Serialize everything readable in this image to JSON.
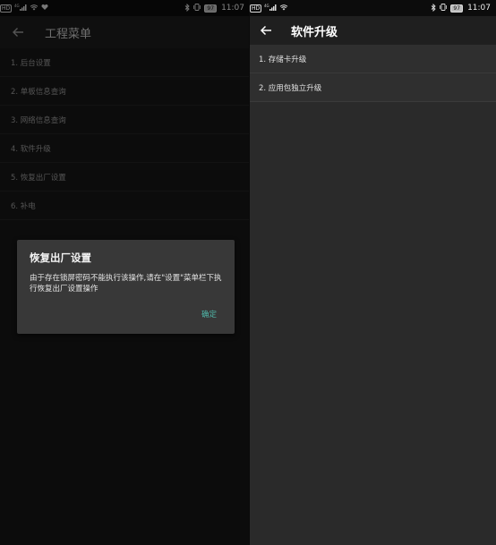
{
  "left_screen": {
    "status_bar": {
      "hd": "HD",
      "signal": "4G",
      "battery": "97",
      "time": "11:07"
    },
    "app_bar": {
      "title": "工程菜单"
    },
    "menu_items": [
      {
        "label": "1. 后台设置"
      },
      {
        "label": "2. 单板信息查询"
      },
      {
        "label": "3. 网络信息查询"
      },
      {
        "label": "4. 软件升级"
      },
      {
        "label": "5. 恢复出厂设置"
      },
      {
        "label": "6. 补电"
      }
    ],
    "dialog": {
      "title": "恢复出厂设置",
      "message": "由于存在锁屏密码不能执行该操作,请在\"设置\"菜单栏下执行恢复出厂设置操作",
      "confirm_label": "确定"
    }
  },
  "right_screen": {
    "status_bar": {
      "hd": "HD",
      "signal": "4G",
      "battery": "97",
      "time": "11:07"
    },
    "app_bar": {
      "title": "软件升级"
    },
    "menu_items": [
      {
        "label": "1. 存储卡升级"
      },
      {
        "label": "2. 应用包独立升级"
      }
    ]
  },
  "colors": {
    "accent": "#4fb6a8",
    "dialog_bg": "#383838",
    "right_bg": "#2a2a2a"
  }
}
